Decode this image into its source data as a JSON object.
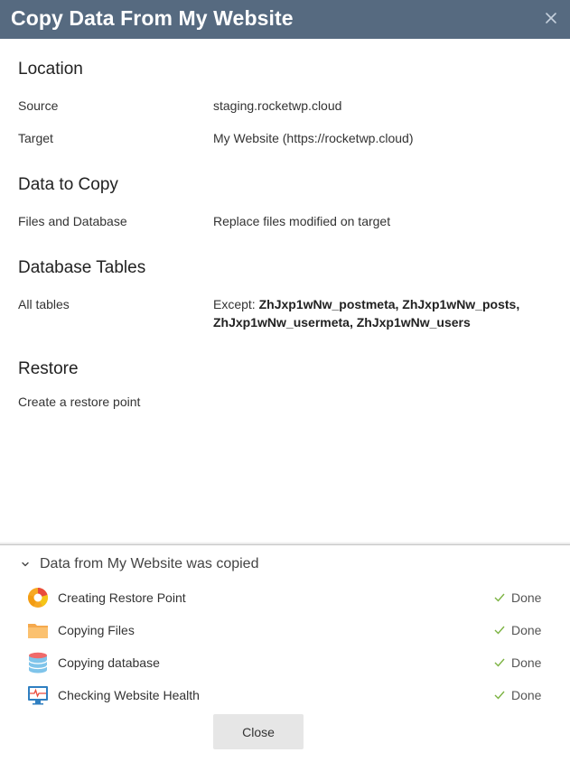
{
  "dialog": {
    "title": "Copy Data From My Website",
    "close_icon": "close-icon"
  },
  "location": {
    "heading": "Location",
    "source_label": "Source",
    "source_value": "staging.rocketwp.cloud",
    "target_label": "Target",
    "target_value": "My Website (https://rocketwp.cloud)"
  },
  "data_to_copy": {
    "heading": "Data to Copy",
    "label": "Files and Database",
    "value": "Replace files modified on target"
  },
  "database_tables": {
    "heading": "Database Tables",
    "label": "All tables",
    "except_prefix": "Except:",
    "except_line1": "ZhJxp1wNw_postmeta, ZhJxp1wNw_posts,",
    "except_line2": "ZhJxp1wNw_usermeta, ZhJxp1wNw_users"
  },
  "restore": {
    "heading": "Restore",
    "label": "Create a restore point"
  },
  "progress_panel": {
    "title": "Data from My Website was copied",
    "chevron_icon": "chevron-down-icon",
    "steps": [
      {
        "label": "Creating Restore Point",
        "status": "Done",
        "icon": "restore-point-icon"
      },
      {
        "label": "Copying Files",
        "status": "Done",
        "icon": "folder-icon"
      },
      {
        "label": "Copying database",
        "status": "Done",
        "icon": "database-icon"
      },
      {
        "label": "Checking Website Health",
        "status": "Done",
        "icon": "health-monitor-icon"
      }
    ]
  },
  "footer": {
    "close_label": "Close"
  },
  "colors": {
    "titlebar": "#566a80",
    "done_check": "#7cb342",
    "button": "#e6e6e6"
  }
}
